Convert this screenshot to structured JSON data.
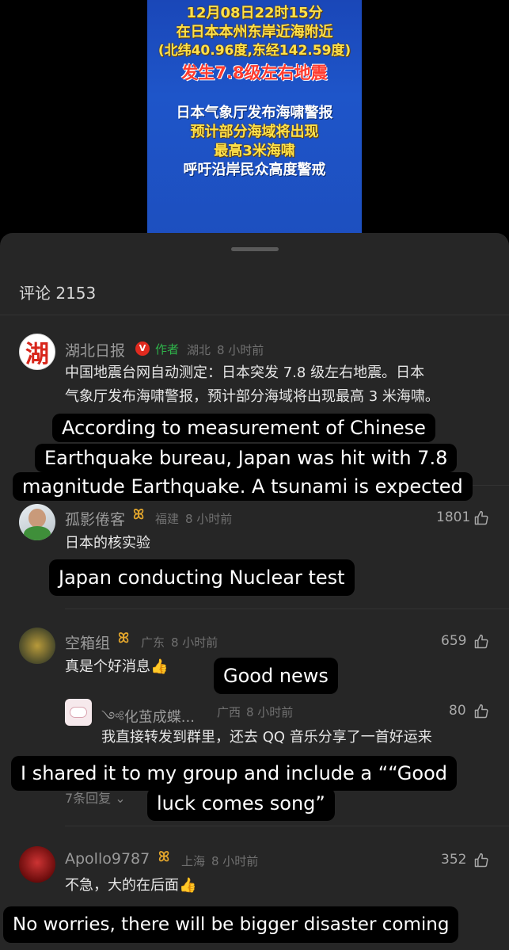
{
  "video": {
    "lines": [
      "12月08日22时15分",
      "在日本本州东岸近海附近",
      "(北纬40.96度,东经142.59度)",
      "发生7.8级左右地震",
      "日本气象厅发布海啸警报",
      "预计部分海域将出现",
      "最高3米海啸",
      "呼吁沿岸民众高度警戒"
    ]
  },
  "sheet": {
    "title": "评论 2153"
  },
  "comments": [
    {
      "avatar_text": "湖",
      "name": "湖北日报",
      "verified": "V",
      "author_tag": "作者",
      "location": "湖北",
      "time": "8 小时前",
      "text_line1": "中国地震台网自动测定：日本突发 7.8 级左右地震。日本",
      "text_line2": "气象厅发布海啸警报，预计部分海域将出现最高 3 米海啸。"
    },
    {
      "name": "孤影倦客",
      "location": "福建",
      "time": "8 小时前",
      "likes": "1801",
      "text": "日本的核实验"
    },
    {
      "name": "空箱组",
      "location": "广东",
      "time": "8 小时前",
      "likes": "659",
      "text": "真是个好消息👍",
      "reply": {
        "name": "༺化茧成蝶...",
        "location": "广西",
        "time": "8 小时前",
        "likes": "80",
        "text": "我直接转发到群里，还去 QQ 音乐分享了一首好运来"
      },
      "more_replies": "7条回复"
    },
    {
      "name": "Apollo9787",
      "location": "上海",
      "time": "8 小时前",
      "likes": "352",
      "text": "不急，大的在后面👍"
    }
  ],
  "captions": {
    "c1_line1": "According to measurement of Chinese",
    "c1_line2": "Earthquake bureau, Japan was hit with 7.8",
    "c1_line3": "magnitude Earthquake. A tsunami is expected",
    "c2": "Japan conducting Nuclear test",
    "c3": "Good news",
    "c4_line1": "I shared it to my group and include a ““Good",
    "c4_line2": "luck comes song”",
    "c5": "No worries, there will be bigger disaster coming"
  },
  "colors": {
    "sheet_bg": "#262626",
    "video_blue": "#1e55c9",
    "author_green": "#2fb34a",
    "vip_gold": "#e3a62c"
  }
}
